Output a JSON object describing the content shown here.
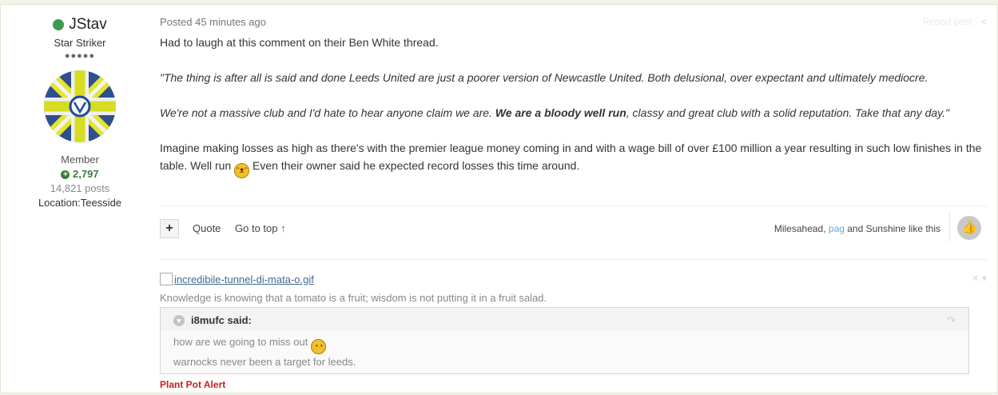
{
  "author": {
    "name": "JStav",
    "rank_title": "Star Striker",
    "rank_pips": "●●●●●",
    "group": "Member",
    "reputation": "2,797",
    "posts": "14,821 posts",
    "location": "Location:Teesside",
    "status_color": "#3d9b50"
  },
  "post": {
    "posted_label": "Posted 45 minutes ago",
    "report_label": "Report post",
    "paragraphs": {
      "p1": "Had to laugh at this comment on their Ben White thread.",
      "p2": "\"The thing is after all is said and done Leeds United are just a poorer version of Newcastle United. Both delusional, over expectant and ultimately mediocre.",
      "p3a": "We're not a massive club and I'd hate to hear anyone claim we are. ",
      "p3b": "We are a bloody well run",
      "p3c": ", classy and great club with a solid reputation. Take that any day.\"",
      "p4a": "Imagine making losses as high as there's with the premier league money coming in and with a wage bill of over £100 million a year resulting in such low finishes in the table.  Well run ",
      "p4b": " Even their owner said he expected record losses this time around."
    }
  },
  "controls": {
    "multiquote_label": "+",
    "quote_label": "Quote",
    "go_to_top_label": "Go to top",
    "likes_prefix": "Milesahead, ",
    "likes_link": "pag",
    "likes_suffix": " and Sunshine like this"
  },
  "signature": {
    "image_link": "incredibile-tunnel-di-mata-o.gif",
    "text": "Knowledge is knowing that a tomato is a fruit; wisdom is not putting it in a fruit salad.",
    "quote": {
      "author": "i8mufc said:",
      "line1": "how are we going to miss out",
      "line2": "warnocks never been a target for leeds."
    },
    "footer": "Plant Pot Alert"
  },
  "colors": {
    "accent_blue": "#3e6790",
    "link_light": "#5cb0e0",
    "alert_red": "#c81e1e",
    "reputation_green": "#3c7d3c"
  }
}
